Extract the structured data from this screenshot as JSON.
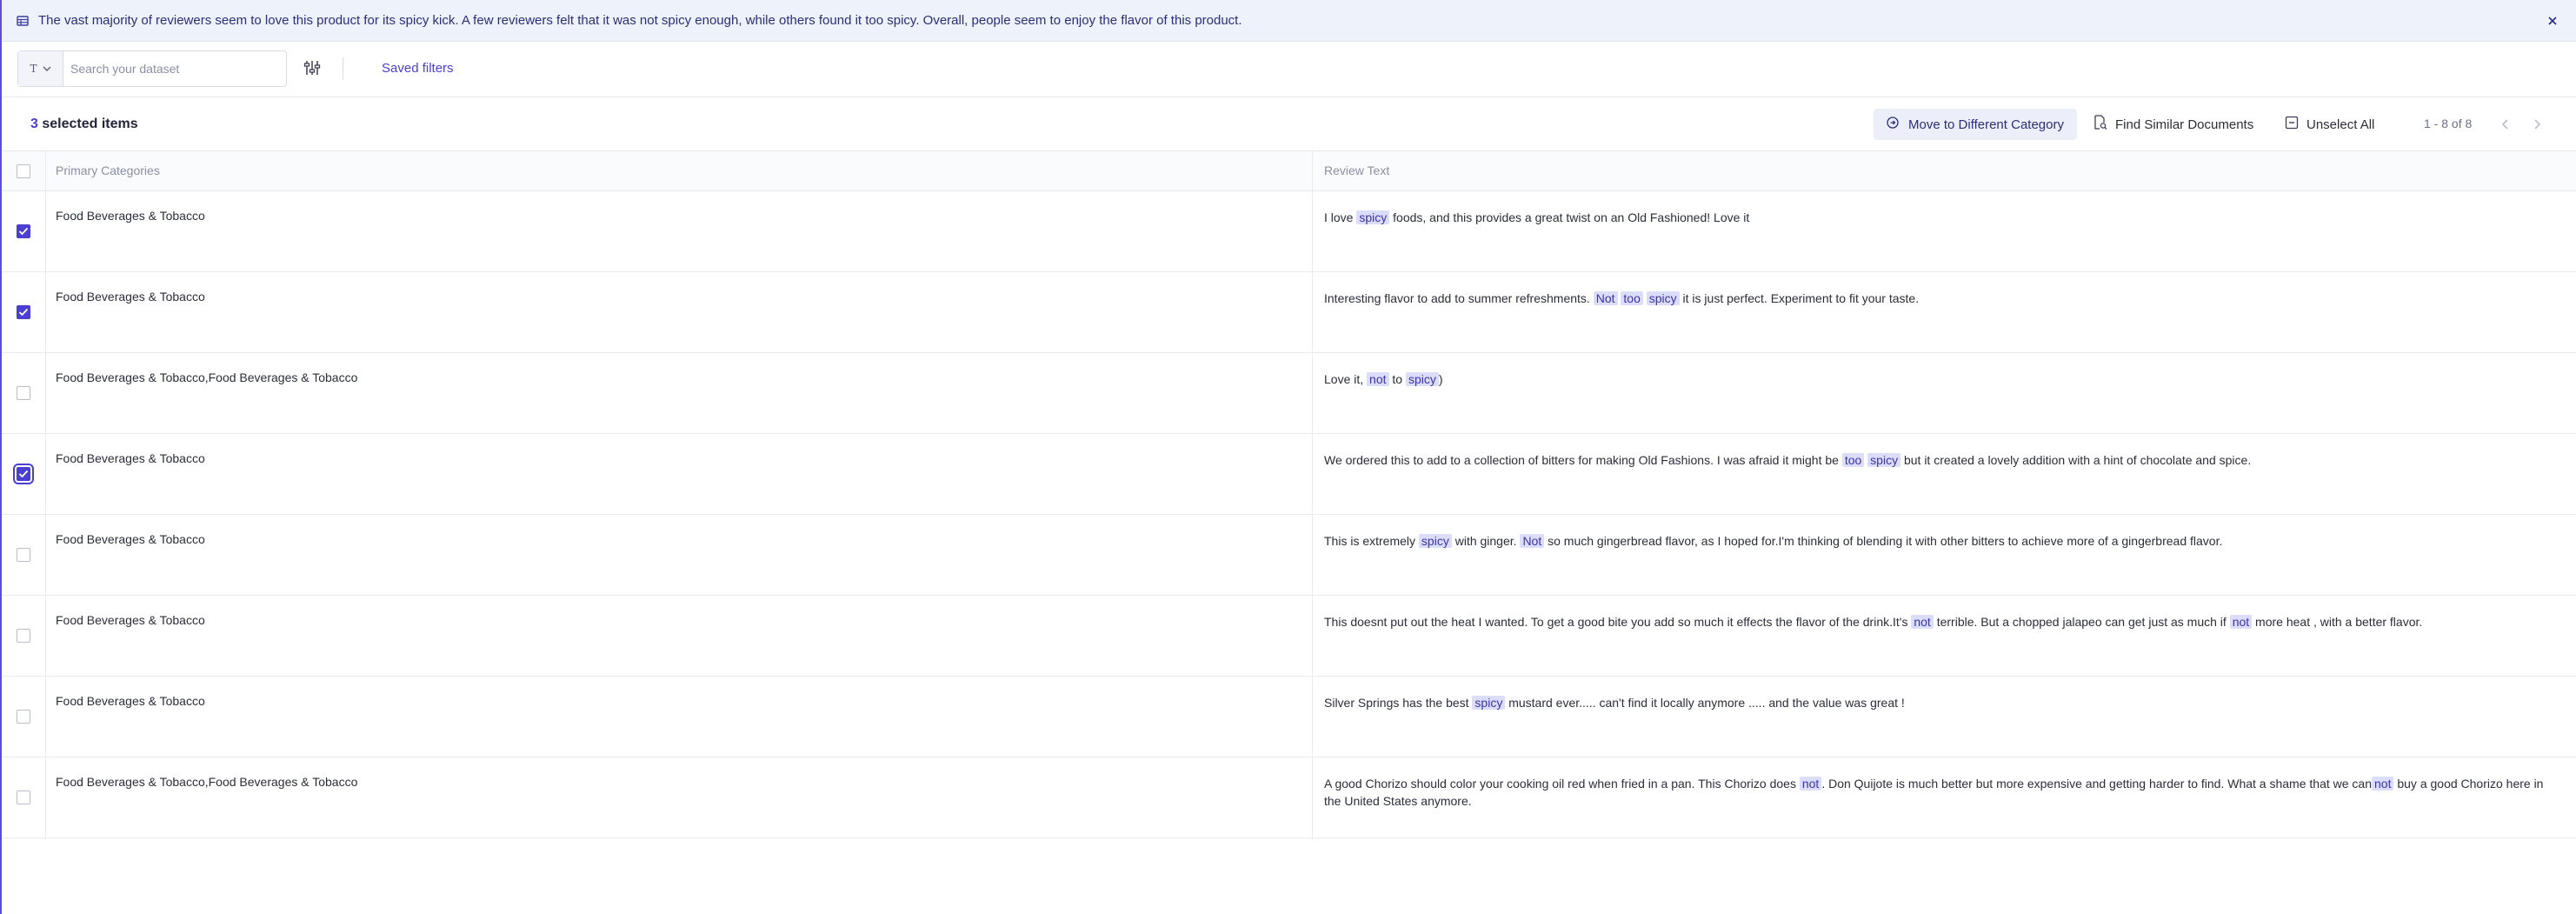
{
  "banner": {
    "text": "The vast majority of reviewers seem to love this product for its spicy kick. A few reviewers felt that it was not spicy enough, while others found it too spicy. Overall, people seem to enjoy the flavor of this product.",
    "icon": "table-icon",
    "close_icon": "close-icon"
  },
  "search": {
    "type_label": "T",
    "placeholder": "Search your dataset",
    "value": "",
    "filter_icon": "sliders-icon",
    "saved_filters_label": "Saved filters"
  },
  "selection": {
    "count": "3",
    "label": " selected items",
    "move_label": "Move to Different Category",
    "similar_label": "Find Similar Documents",
    "unselect_label": "Unselect All",
    "pagination": "1 - 8 of 8"
  },
  "table": {
    "headers": {
      "category": "Primary Categories",
      "text": "Review Text"
    },
    "rows": [
      {
        "checked": true,
        "category": "Food Beverages & Tobacco",
        "text": [
          {
            "t": "I love "
          },
          {
            "t": "spicy",
            "hl": true
          },
          {
            "t": " foods, and this provides a great twist on an Old Fashioned! Love it"
          }
        ]
      },
      {
        "checked": true,
        "category": "Food Beverages & Tobacco",
        "text": [
          {
            "t": "Interesting flavor to add to summer refreshments. "
          },
          {
            "t": "Not",
            "hl": true
          },
          {
            "t": " "
          },
          {
            "t": "too",
            "hl": true
          },
          {
            "t": " "
          },
          {
            "t": "spicy",
            "hl": true
          },
          {
            "t": " it is just perfect. Experiment to fit your taste."
          }
        ]
      },
      {
        "checked": false,
        "category": "Food Beverages & Tobacco,Food Beverages & Tobacco",
        "text": [
          {
            "t": "Love it, "
          },
          {
            "t": "not",
            "hl": true
          },
          {
            "t": " to "
          },
          {
            "t": "spicy",
            "hl": true
          },
          {
            "t": ")"
          }
        ]
      },
      {
        "checked": true,
        "focused": true,
        "category": "Food Beverages & Tobacco",
        "text": [
          {
            "t": "We ordered this to add to a collection of bitters for making Old Fashions. I was afraid it might be "
          },
          {
            "t": "too",
            "hl": true
          },
          {
            "t": " "
          },
          {
            "t": "spicy",
            "hl": true
          },
          {
            "t": " but it created a lovely addition with a hint of chocolate and spice."
          }
        ]
      },
      {
        "checked": false,
        "category": "Food Beverages & Tobacco",
        "text": [
          {
            "t": "This is extremely "
          },
          {
            "t": "spicy",
            "hl": true
          },
          {
            "t": " with ginger. "
          },
          {
            "t": "Not",
            "hl": true
          },
          {
            "t": " so much gingerbread flavor, as I hoped for.I'm thinking of blending it with other bitters to achieve more of a gingerbread flavor."
          }
        ]
      },
      {
        "checked": false,
        "category": "Food Beverages & Tobacco",
        "text": [
          {
            "t": "This doesnt put out the heat I wanted. To get a good bite you add so much it effects the flavor of the drink.It's "
          },
          {
            "t": "not",
            "hl": true
          },
          {
            "t": " terrible. But a chopped jalapeo can get just as much if "
          },
          {
            "t": "not",
            "hl": true
          },
          {
            "t": " more heat , with a better flavor."
          }
        ]
      },
      {
        "checked": false,
        "category": "Food Beverages & Tobacco",
        "text": [
          {
            "t": "Silver Springs has the best "
          },
          {
            "t": "spicy",
            "hl": true
          },
          {
            "t": " mustard ever..... can't find it locally anymore ..... and the value was great !"
          }
        ]
      },
      {
        "checked": false,
        "category": "Food Beverages & Tobacco,Food Beverages & Tobacco",
        "text": [
          {
            "t": "A good Chorizo should color your cooking oil red when fried in a pan. This Chorizo does "
          },
          {
            "t": "not",
            "hl": true
          },
          {
            "t": ". Don Quijote is much better but more expensive and getting harder to find. What a shame that we can"
          },
          {
            "t": "not",
            "hl": true
          },
          {
            "t": " buy a good Chorizo here in the United States anymore."
          }
        ]
      }
    ]
  },
  "colors": {
    "accent": "#4a3fd0",
    "banner_bg": "#eef2fb",
    "highlight": "#dcdcfb"
  }
}
